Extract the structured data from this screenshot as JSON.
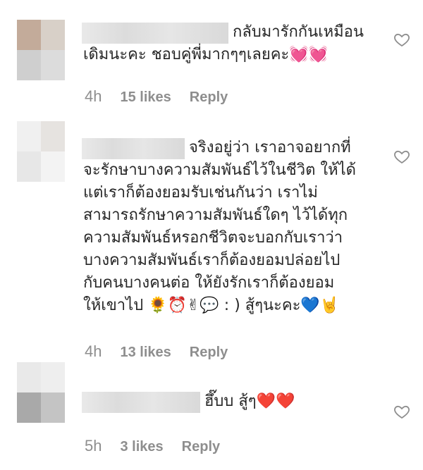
{
  "comments": [
    {
      "avatar_colors": [
        "#c3ab9a",
        "#d8d0c8",
        "#cfcfcf",
        "#dcdcdc"
      ],
      "text_lines": [
        "กลับมารักกันเหมือน",
        "เดิมนะคะ ชอบคู่พี่มากๆๆเลยคะ💓💓"
      ],
      "time": "4h",
      "likes": "15 likes",
      "reply": "Reply",
      "heart_icon": "heart-outline-icon"
    },
    {
      "avatar_colors": [
        "#f0f0f0",
        "#e6e3e0",
        "#e7e7e7",
        "#f3f3f3"
      ],
      "text_lines": [
        "จริงอยู่ว่า เราอาจอยากที่",
        "จะรักษาบางความสัมพันธ์ไว้ในชีวิต ให้ได้",
        "แต่เราก็ต้องยอมรับเช่นกันว่า เราไม่",
        "สามารถรักษาความสัมพันธ์ใดๆ ไว้ได้ทุก",
        "ความสัมพันธ์หรอกชีวิตจะบอกกับเราว่า",
        "บางความสัมพันธ์เราก็ต้องยอมปล่อยไป",
        "กับคนบางคนต่อ ให้ยังรักเราก็ต้องยอม",
        "ให้เขาไป 🌻⏰✌💬 : ) สู้ๆนะคะ💙🤘"
      ],
      "time": "4h",
      "likes": "13 likes",
      "reply": "Reply",
      "heart_icon": "heart-outline-icon"
    },
    {
      "avatar_colors": [
        "#e9e9e9",
        "#eeeeee",
        "#a9a9a9",
        "#c4c4c4"
      ],
      "text_lines": [
        "ฮึ๊บบ สู้ๆ❤️❤️"
      ],
      "time": "5h",
      "likes": "3 likes",
      "reply": "Reply",
      "heart_icon": "heart-outline-icon"
    }
  ]
}
